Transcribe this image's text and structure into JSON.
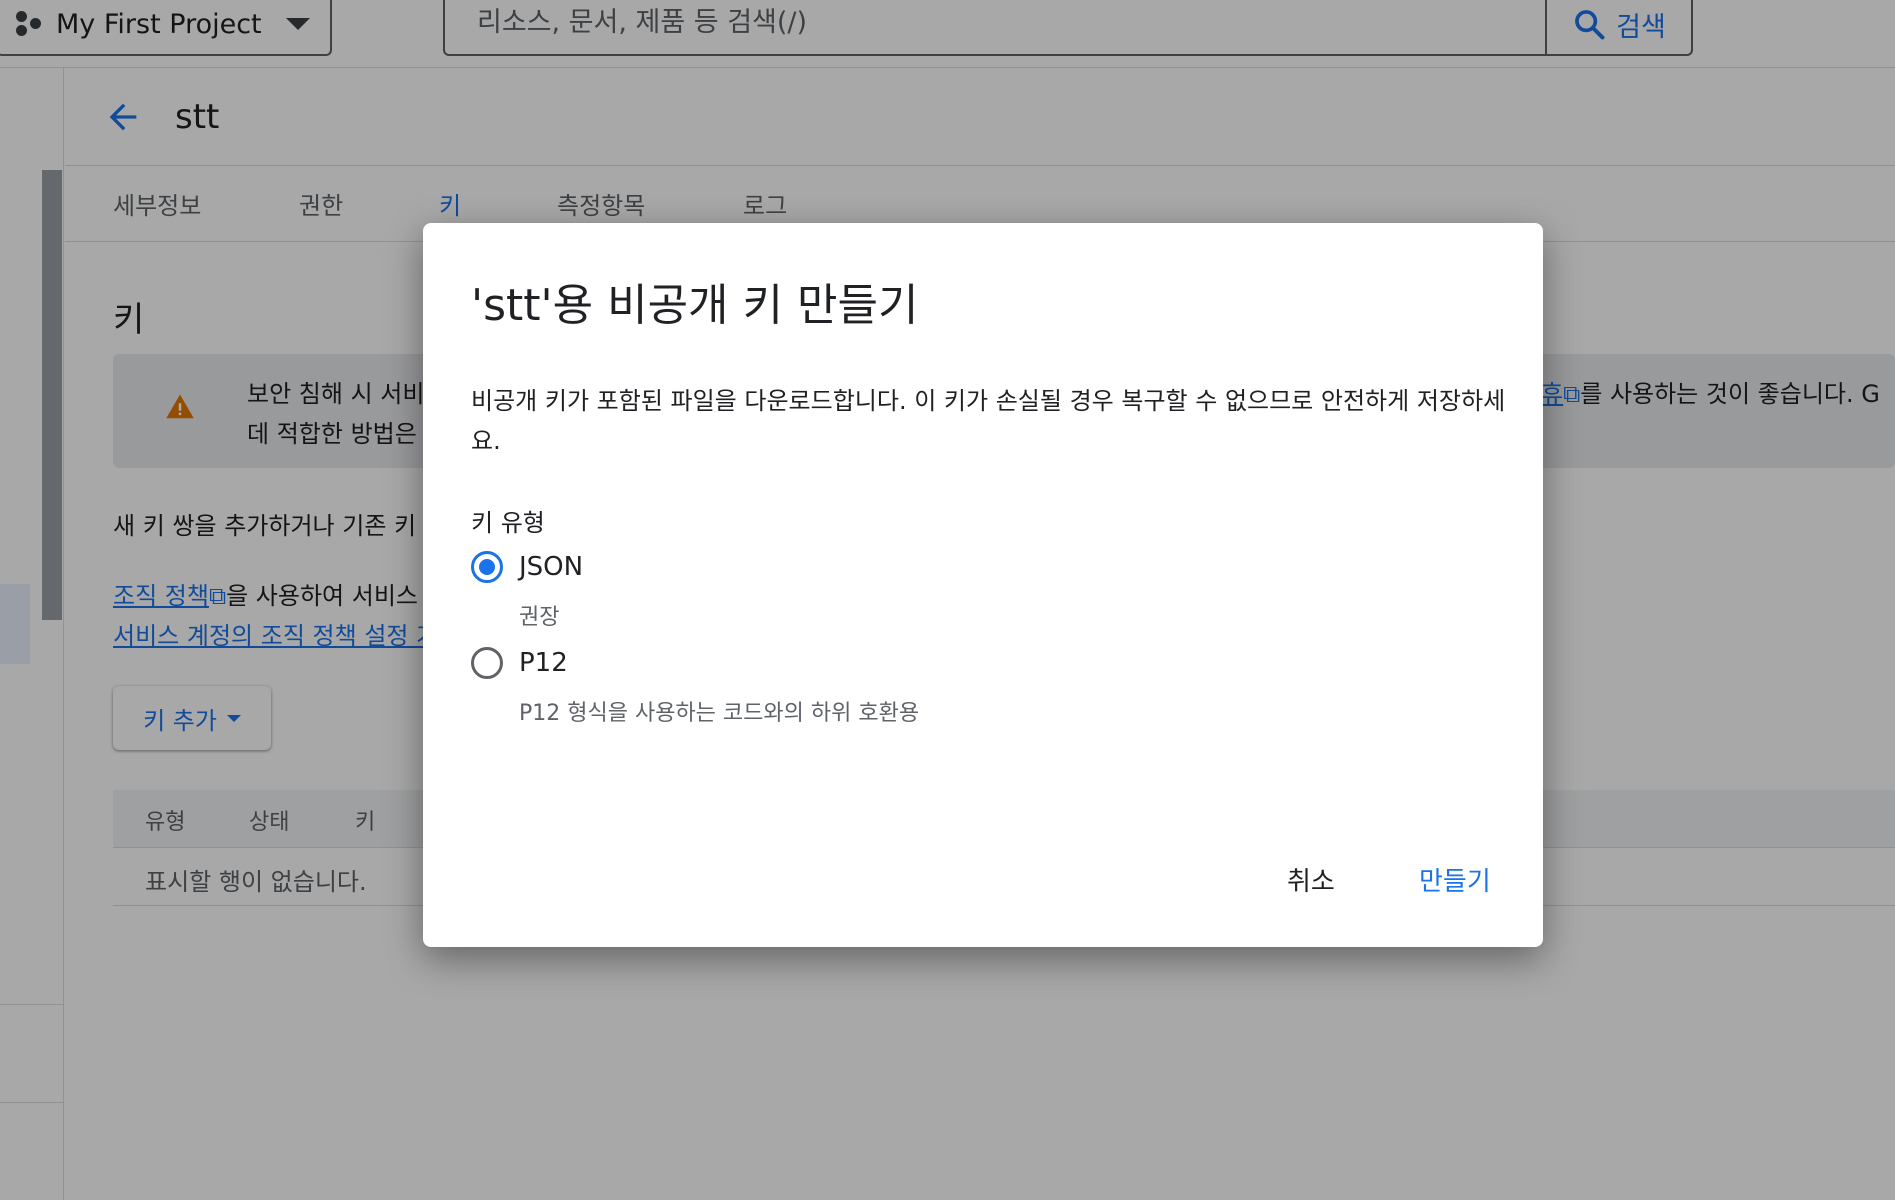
{
  "topbar": {
    "project_name": "My First Project",
    "search_placeholder": "리소스, 문서, 제품 등 검색(/)",
    "search_button_label": "검색"
  },
  "page": {
    "title": "stt",
    "tabs": [
      {
        "label": "세부정보"
      },
      {
        "label": "권한"
      },
      {
        "label": "키",
        "active": true
      },
      {
        "label": "측정항목"
      },
      {
        "label": "로그"
      }
    ],
    "section_title": "키",
    "warning": {
      "line1": "보안 침해 시 서비",
      "line2": "데 적합한 방법은",
      "tail_link": "휴",
      "tail_text": "를 사용하는 것이 좋습니다. G"
    },
    "intro": "새 키 쌍을 추가하거나 기존 키",
    "policy_link1": "조직 정책",
    "policy_text1": "을 사용하여 서비스",
    "policy_link2": "서비스 계정의 조직 정책 설정 가",
    "add_key_label": "키 추가",
    "table": {
      "headers": [
        "유형",
        "상태",
        "키"
      ],
      "empty_message": "표시할 행이 없습니다."
    }
  },
  "dialog": {
    "title": "'stt'용 비공개 키 만들기",
    "description": "비공개 키가 포함된 파일을 다운로드합니다. 이 키가 손실될 경우 복구할 수 없으므로 안전하게 저장하세요.",
    "key_type_label": "키 유형",
    "options": [
      {
        "label": "JSON",
        "sublabel": "권장",
        "selected": true
      },
      {
        "label": "P12",
        "sublabel": "P12 형식을 사용하는 코드와의 하위 호환용",
        "selected": false
      }
    ],
    "cancel_label": "취소",
    "create_label": "만들기"
  },
  "colors": {
    "accent": "#1a73e8",
    "warning_icon": "#e37400",
    "scrim": "rgba(0,0,0,0.34)"
  }
}
